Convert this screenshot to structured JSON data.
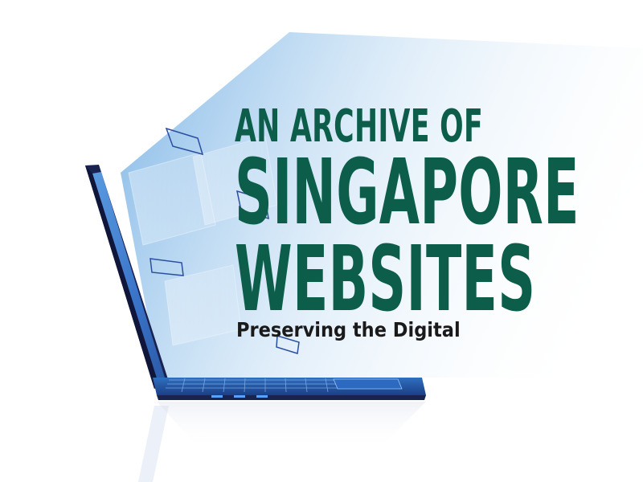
{
  "title": {
    "line1": "AN ARCHIVE OF",
    "line2": "SINGAPORE",
    "line3": "WEBSITES"
  },
  "subtitle": "Preserving the Digital",
  "illustration": {
    "subject": "laptop-icon",
    "accent_color": "#0c5e4a",
    "screen_color": "#3a7bd5",
    "body_color": "#1a2250"
  }
}
